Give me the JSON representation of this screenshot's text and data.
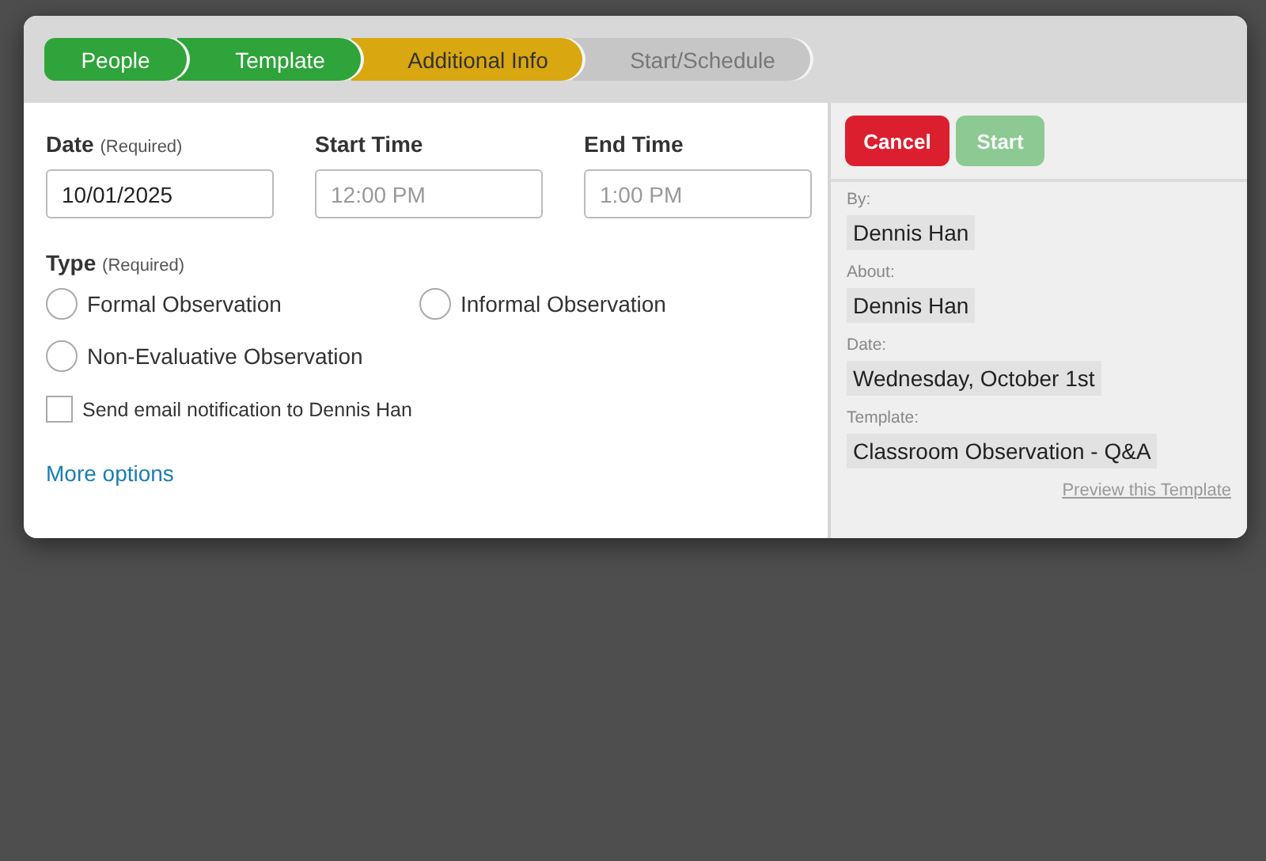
{
  "steps": [
    {
      "label": "People",
      "kind": "complete"
    },
    {
      "label": "Template",
      "kind": "complete"
    },
    {
      "label": "Additional Info",
      "kind": "current"
    },
    {
      "label": "Start/Schedule",
      "kind": "pending"
    }
  ],
  "form": {
    "date": {
      "label": "Date",
      "hint": "(Required)",
      "value": "10/01/2025"
    },
    "start_time": {
      "label": "Start Time",
      "placeholder": "12:00 PM"
    },
    "end_time": {
      "label": "End Time",
      "placeholder": "1:00 PM"
    },
    "type": {
      "label": "Type",
      "hint": "(Required)",
      "options": [
        {
          "label": "Formal Observation",
          "selected": false
        },
        {
          "label": "Informal Observation",
          "selected": false
        },
        {
          "label": "Non-Evaluative Observation",
          "selected": false
        }
      ]
    },
    "notify": {
      "label": "Send email notification to Dennis Han",
      "checked": false
    },
    "more_options": "More options"
  },
  "buttons": [
    {
      "label": "Cancel",
      "kind": "danger",
      "disabled": false
    },
    {
      "label": "Start",
      "kind": "primary",
      "disabled": true
    }
  ],
  "summary": [
    {
      "label": "By:",
      "value": "Dennis Han"
    },
    {
      "label": "About:",
      "value": "Dennis Han"
    },
    {
      "label": "Date:",
      "value": "Wednesday, October 1st"
    },
    {
      "label": "Template:",
      "value": "Classroom Observation - Q&A"
    }
  ],
  "preview_link": "Preview this Template"
}
